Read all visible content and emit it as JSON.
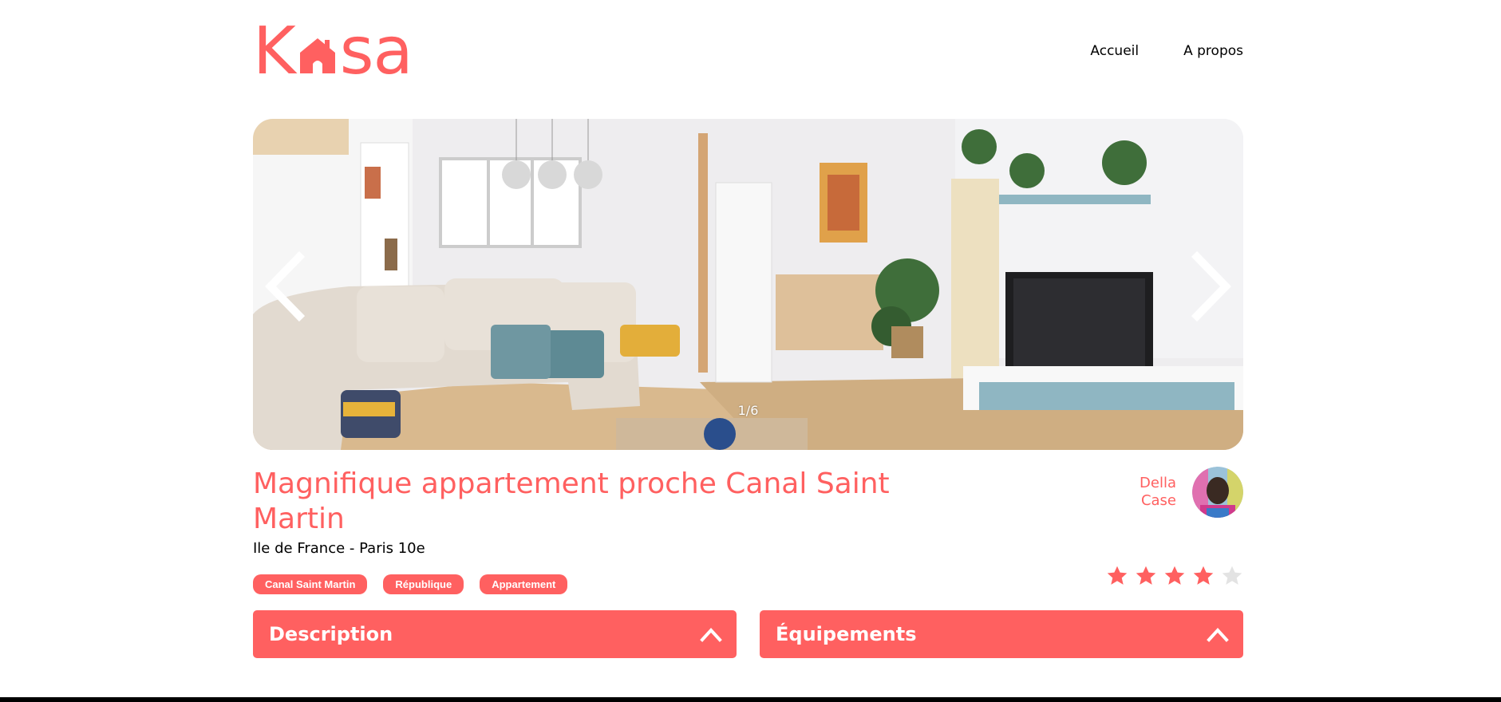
{
  "header": {
    "logo": {
      "text_before": "K",
      "text_after": "sa",
      "icon": "house-icon"
    },
    "nav": [
      {
        "label": "Accueil"
      },
      {
        "label": "A propos"
      }
    ]
  },
  "carousel": {
    "counter": "1/6",
    "prev_icon": "chevron-left-icon",
    "next_icon": "chevron-right-icon",
    "current_index": 1,
    "total": 6
  },
  "listing": {
    "title": "Magnifique appartement proche Canal Saint Martin",
    "location": "Ile de France - Paris 10e",
    "tags": [
      "Canal Saint Martin",
      "République",
      "Appartement"
    ],
    "host": {
      "first_name": "Della",
      "last_name": "Case"
    },
    "rating": 4,
    "rating_max": 5
  },
  "collapses": [
    {
      "title": "Description",
      "icon": "chevron-up-icon"
    },
    {
      "title": "Équipements",
      "icon": "chevron-up-icon"
    }
  ],
  "colors": {
    "accent": "#FF6060",
    "star_empty": "#E3E3E3",
    "text": "#000000"
  }
}
